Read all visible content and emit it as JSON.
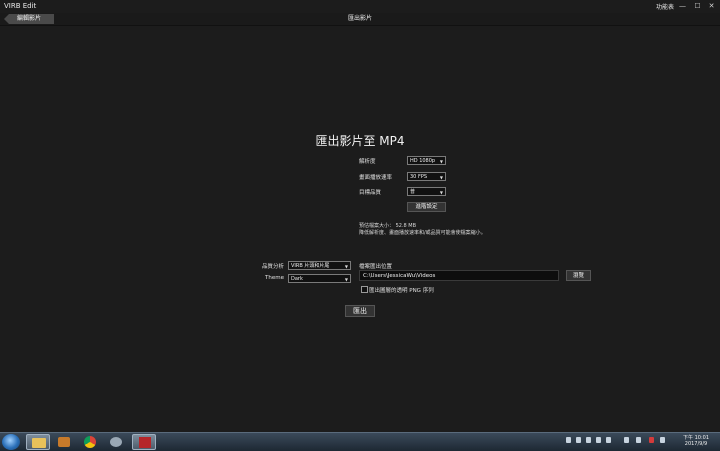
{
  "window": {
    "title": "VIRB Edit",
    "menu_label": "功能表",
    "minimize": "—",
    "maximize": "☐",
    "close": "✕"
  },
  "nav": {
    "back_label": "編輯影片",
    "title": "匯出影片"
  },
  "export": {
    "heading": "匯出影片至 MP4",
    "resolution_label": "解析度",
    "resolution_value": "HD 1080p",
    "framerate_label": "畫面播放速率",
    "framerate_value": "30 FPS",
    "quality_label": "目標品質",
    "quality_value": "普",
    "advanced_button": "進階設定",
    "file_size": "預估檔案大小： 52.8 MB",
    "note": "降低解析度、畫面播放速率和/或品質可能會使檔案縮小。",
    "stabilize_label": "品質分析",
    "stabilize_value": "VIRB 片頭和片尾",
    "theme_label": "Theme",
    "theme_value": "Dark",
    "location_label": "檔案匯出位置",
    "location_value": "C:\\Users\\JessicaWu\\Videos",
    "browse_button": "瀏覽",
    "png_option": "匯出圖層的透明 PNG 序列",
    "export_button": "匯出"
  },
  "taskbar": {
    "time": "下午 10:01",
    "date": "2017/9/9"
  }
}
